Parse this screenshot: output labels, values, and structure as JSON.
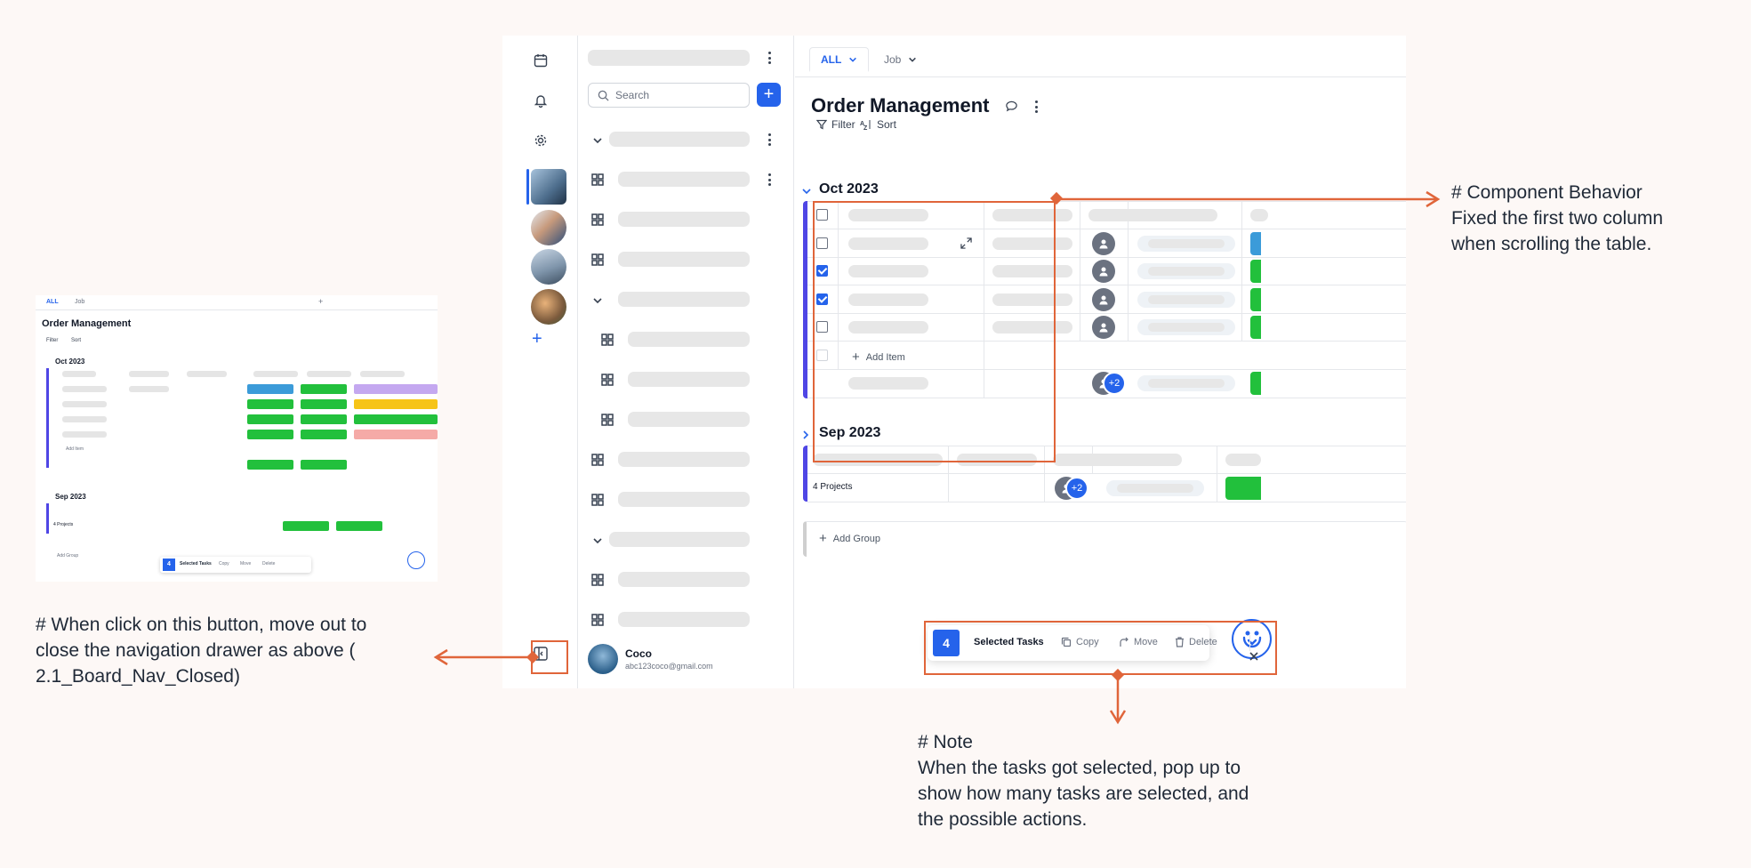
{
  "main": {
    "tabs": [
      {
        "label": "ALL",
        "active": true
      },
      {
        "label": "Job",
        "active": false
      }
    ],
    "title": "Order Management",
    "toolbar": {
      "filter": "Filter",
      "sort": "Sort"
    },
    "groups": [
      {
        "name": "Oct 2023",
        "expanded": true,
        "add_item": "Add Item",
        "checked_rows": [
          false,
          false,
          true,
          true,
          false
        ],
        "extra_members": "+2",
        "accent": "#4f46e5"
      },
      {
        "name": "Sep 2023",
        "expanded": false,
        "summary": "4 Projects",
        "extra_members": "+2",
        "accent": "#4f46e5"
      }
    ],
    "add_group": "Add Group",
    "selection_bar": {
      "count": "4",
      "label": "Selected Tasks",
      "copy": "Copy",
      "move": "Move",
      "delete": "Delete"
    }
  },
  "drawer": {
    "search_placeholder": "Search",
    "user": {
      "name": "Coco",
      "email": "abc123coco@gmail.com"
    }
  },
  "mini_preview": {
    "tabs": [
      "ALL",
      "Job"
    ],
    "title": "Order Management",
    "toolbar": {
      "filter": "Filter",
      "sort": "Sort"
    },
    "group1": "Oct 2023",
    "add_item": "Add Item",
    "group2": "Sep 2023",
    "summary": "4 Projects",
    "add_group": "Add Group",
    "selection": {
      "count": "4",
      "label": "Selected Tasks",
      "copy": "Copy",
      "move": "Move",
      "delete": "Delete"
    }
  },
  "annotations": {
    "component_behavior": [
      "# Component Behavior",
      "Fixed the first two column",
      "when scrolling the table."
    ],
    "nav_button": [
      "# When click on this button, move out to",
      "close the navigation drawer as above (",
      "2.1_Board_Nav_Closed)"
    ],
    "note": [
      "# Note",
      "When the tasks got selected, pop up to",
      "show how many tasks are selected, and",
      "the possible actions."
    ]
  },
  "colors": {
    "accent": "#2563eb",
    "group_bar": "#4f46e5",
    "annotation": "#e0653a",
    "status_green": "#22c03c",
    "status_blue": "#3b9bd9"
  }
}
